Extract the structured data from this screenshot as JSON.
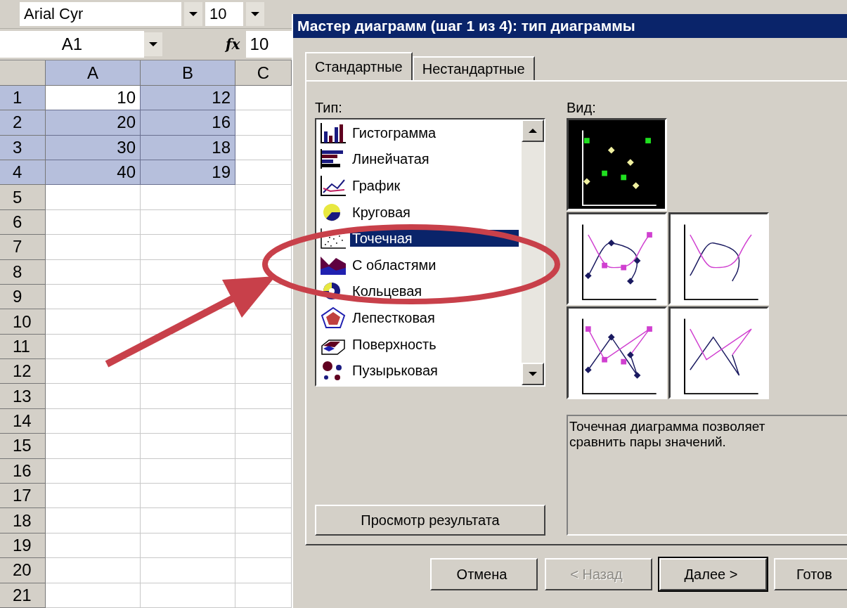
{
  "toolbar": {
    "font": "Arial Cyr",
    "size": "10"
  },
  "formula_bar": {
    "name_box": "A1",
    "fx": "fx",
    "value": "10"
  },
  "sheet": {
    "columns": [
      {
        "label": "A",
        "selected": true
      },
      {
        "label": "B",
        "selected": true
      },
      {
        "label": "C",
        "selected": false
      }
    ],
    "rows": [
      {
        "header": "1",
        "selected": true,
        "cells": [
          {
            "value": "10",
            "selected": true,
            "active": true
          },
          {
            "value": "12",
            "selected": true,
            "active": false
          }
        ]
      },
      {
        "header": "2",
        "selected": true,
        "cells": [
          {
            "value": "20",
            "selected": true,
            "active": false
          },
          {
            "value": "16",
            "selected": true,
            "active": false
          }
        ]
      },
      {
        "header": "3",
        "selected": true,
        "cells": [
          {
            "value": "30",
            "selected": true,
            "active": false
          },
          {
            "value": "18",
            "selected": true,
            "active": false
          }
        ]
      },
      {
        "header": "4",
        "selected": true,
        "cells": [
          {
            "value": "40",
            "selected": true,
            "active": false
          },
          {
            "value": "19",
            "selected": true,
            "active": false
          }
        ]
      },
      {
        "header": "5",
        "selected": false
      },
      {
        "header": "6",
        "selected": false
      },
      {
        "header": "7",
        "selected": false
      },
      {
        "header": "8",
        "selected": false
      },
      {
        "header": "9",
        "selected": false
      },
      {
        "header": "10",
        "selected": false
      },
      {
        "header": "11",
        "selected": false
      },
      {
        "header": "12",
        "selected": false
      },
      {
        "header": "13",
        "selected": false
      },
      {
        "header": "14",
        "selected": false
      },
      {
        "header": "15",
        "selected": false
      },
      {
        "header": "16",
        "selected": false
      },
      {
        "header": "17",
        "selected": false
      },
      {
        "header": "18",
        "selected": false
      },
      {
        "header": "19",
        "selected": false
      },
      {
        "header": "20",
        "selected": false
      },
      {
        "header": "21",
        "selected": false
      }
    ]
  },
  "dialog": {
    "title": "Мастер диаграмм (шаг 1 из 4): тип диаграммы",
    "tabs": [
      {
        "label": "Стандартные",
        "selected": true
      },
      {
        "label": "Нестандартные",
        "selected": false
      }
    ],
    "type_label": "Тип:",
    "types": [
      {
        "label": "Гистограмма",
        "kind": "column",
        "selected": false
      },
      {
        "label": "Линейчатая",
        "kind": "bar",
        "selected": false
      },
      {
        "label": "График",
        "kind": "line",
        "selected": false
      },
      {
        "label": "Круговая",
        "kind": "pie",
        "selected": false
      },
      {
        "label": "Точечная",
        "kind": "scatter",
        "selected": true
      },
      {
        "label": "С областями",
        "kind": "area",
        "selected": false
      },
      {
        "label": "Кольцевая",
        "kind": "doughnut",
        "selected": false
      },
      {
        "label": "Лепестковая",
        "kind": "radar",
        "selected": false
      },
      {
        "label": "Поверхность",
        "kind": "surface",
        "selected": false
      },
      {
        "label": "Пузырьковая",
        "kind": "bubble",
        "selected": false
      }
    ],
    "view_label": "Вид:",
    "views": [
      {
        "kind": "markers",
        "selected": true
      },
      {
        "kind": "smooth-markers",
        "selected": false
      },
      {
        "kind": "smooth",
        "selected": false
      },
      {
        "kind": "lines-markers",
        "selected": false
      },
      {
        "kind": "lines",
        "selected": false
      }
    ],
    "description": "Точечная диаграмма позволяет сравнить пары значений.",
    "preview_button": "Просмотр результата",
    "buttons": [
      {
        "label": "Отмена",
        "disabled": false,
        "default": false
      },
      {
        "label": "< Назад",
        "disabled": true,
        "default": false
      },
      {
        "label": "Далее >",
        "disabled": false,
        "default": true
      },
      {
        "label": "Готов",
        "disabled": false,
        "default": false
      }
    ]
  },
  "annotation": {
    "ellipse": true,
    "arrow": true
  }
}
